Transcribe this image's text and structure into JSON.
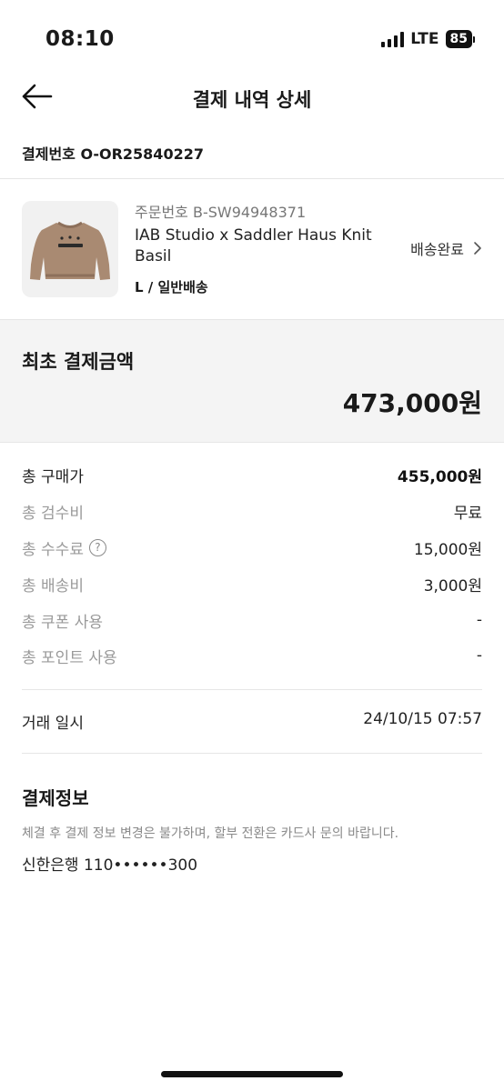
{
  "status_bar": {
    "time": "08:10",
    "network": "LTE",
    "battery": "85"
  },
  "nav": {
    "title": "결제 내역 상세"
  },
  "payment": {
    "number_label": "결제번호 O-OR25840227"
  },
  "product": {
    "order_number": "주문번호 B-SW94948371",
    "name": "IAB Studio x Saddler Haus Knit Basil",
    "option": "L / 일반배송",
    "status": "배송완료"
  },
  "total": {
    "label": "최초 결제금액",
    "amount": "473,000원"
  },
  "breakdown": [
    {
      "label": "총 구매가",
      "value": "455,000원"
    },
    {
      "label": "총 검수비",
      "value": "무료"
    },
    {
      "label": "총 수수료",
      "value": "15,000원"
    },
    {
      "label": "총 배송비",
      "value": "3,000원"
    },
    {
      "label": "총 쿠폰 사용",
      "value": "-"
    },
    {
      "label": "총 포인트 사용",
      "value": "-"
    }
  ],
  "transaction": {
    "label": "거래 일시",
    "value": "24/10/15 07:57"
  },
  "payment_info": {
    "title": "결제정보",
    "notice": "체결 후 결제 정보 변경은 불가하며, 할부 전환은 카드사 문의 바랍니다.",
    "account": "신한은행 110••••••300"
  },
  "colors": {
    "sweater": "#a98a72",
    "summary_bg": "#f4f4f4",
    "muted_text": "#9a9a9a"
  }
}
